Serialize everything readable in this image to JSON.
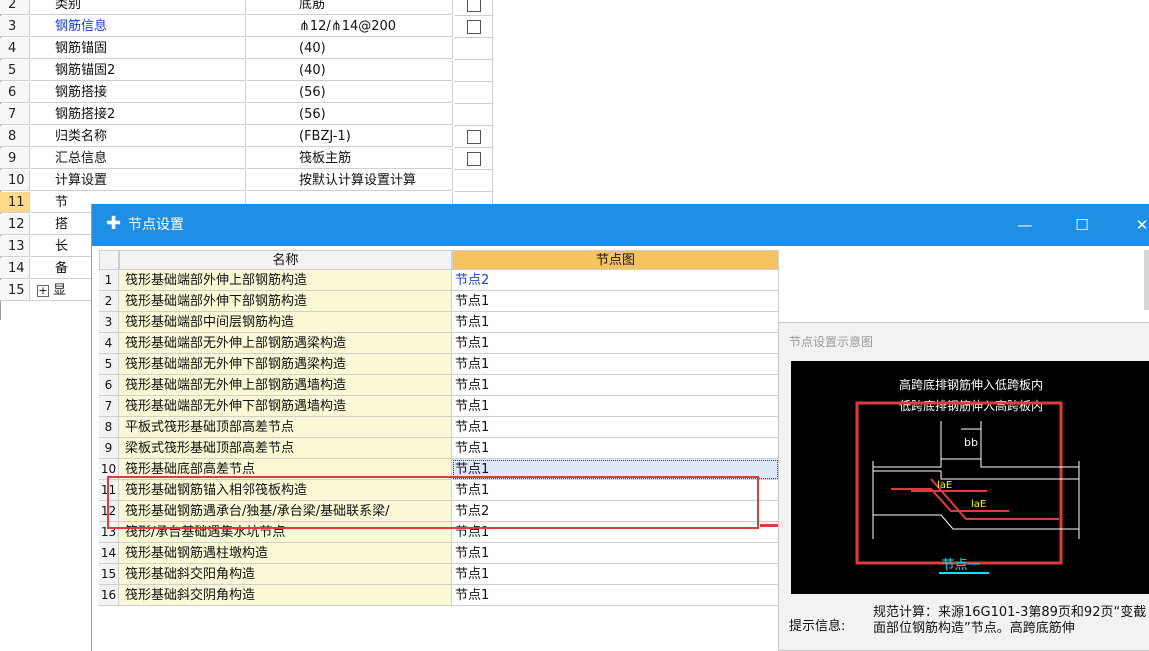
{
  "background_grid": {
    "rows": [
      {
        "num": "2",
        "name": "类别",
        "value": "底筋",
        "checkbox": true,
        "blue": false
      },
      {
        "num": "3",
        "name": "钢筋信息",
        "value": "⋔12/⋔14@200",
        "checkbox": true,
        "blue": true
      },
      {
        "num": "4",
        "name": "钢筋锚固",
        "value": "(40)",
        "checkbox": false,
        "blue": false
      },
      {
        "num": "5",
        "name": "钢筋锚固2",
        "value": "(40)",
        "checkbox": false,
        "blue": false
      },
      {
        "num": "6",
        "name": "钢筋搭接",
        "value": "(56)",
        "checkbox": false,
        "blue": false
      },
      {
        "num": "7",
        "name": "钢筋搭接2",
        "value": "(56)",
        "checkbox": false,
        "blue": false
      },
      {
        "num": "8",
        "name": "归类名称",
        "value": "(FBZJ-1)",
        "checkbox": true,
        "blue": false
      },
      {
        "num": "9",
        "name": "汇总信息",
        "value": "筏板主筋",
        "checkbox": true,
        "blue": false
      },
      {
        "num": "10",
        "name": "计算设置",
        "value": "按默认计算设置计算",
        "checkbox": false,
        "blue": false
      },
      {
        "num": "11",
        "name": "节",
        "value": "",
        "checkbox": false,
        "blue": false,
        "selected": true
      },
      {
        "num": "12",
        "name": "搭",
        "value": "",
        "checkbox": false,
        "blue": false
      },
      {
        "num": "13",
        "name": "长",
        "value": "",
        "checkbox": false,
        "blue": false
      },
      {
        "num": "14",
        "name": "备",
        "value": "",
        "checkbox": false,
        "blue": false
      },
      {
        "num": "15",
        "name": "显",
        "value": "",
        "checkbox": false,
        "blue": false,
        "expand": "+"
      }
    ]
  },
  "dialog": {
    "title": "节点设置",
    "icon": "app-plus-icon",
    "controls": {
      "minimize": "—",
      "maximize": "☐",
      "close": "✕"
    },
    "table": {
      "headers": {
        "name": "名称",
        "image": "节点图"
      },
      "rows": [
        {
          "num": "1",
          "name": "筏形基础端部外伸上部钢筋构造",
          "value": "节点2",
          "blue": true
        },
        {
          "num": "2",
          "name": "筏形基础端部外伸下部钢筋构造",
          "value": "节点1"
        },
        {
          "num": "3",
          "name": "筏形基础端部中间层钢筋构造",
          "value": "节点1"
        },
        {
          "num": "4",
          "name": "筏形基础端部无外伸上部钢筋遇梁构造",
          "value": "节点1"
        },
        {
          "num": "5",
          "name": "筏形基础端部无外伸下部钢筋遇梁构造",
          "value": "节点1"
        },
        {
          "num": "6",
          "name": "筏形基础端部无外伸上部钢筋遇墙构造",
          "value": "节点1"
        },
        {
          "num": "7",
          "name": "筏形基础端部无外伸下部钢筋遇墙构造",
          "value": "节点1"
        },
        {
          "num": "8",
          "name": "平板式筏形基础顶部高差节点",
          "value": "节点1"
        },
        {
          "num": "9",
          "name": "梁板式筏形基础顶部高差节点",
          "value": "节点1"
        },
        {
          "num": "10",
          "name": "筏形基础底部高差节点",
          "value": "节点1",
          "selected": true
        },
        {
          "num": "11",
          "name": "筏形基础钢筋锚入相邻筏板构造",
          "value": "节点1"
        },
        {
          "num": "12",
          "name": "筏形基础钢筋遇承台/独基/承台梁/基础联系梁/",
          "value": "节点2"
        },
        {
          "num": "13",
          "name": "筏形/承台基础遇集水坑节点",
          "value": "节点1"
        },
        {
          "num": "14",
          "name": "筏形基础钢筋遇柱墩构造",
          "value": "节点1"
        },
        {
          "num": "15",
          "name": "筏形基础斜交阳角构造",
          "value": "节点1"
        },
        {
          "num": "16",
          "name": "筏形基础斜交阴角构造",
          "value": "节点1"
        }
      ]
    },
    "preview": {
      "label": "节点设置示意图",
      "diagram_text": {
        "line1": "高跨底排钢筋伸入低跨板内",
        "line2": "低跨底排钢筋伸入高跨板内",
        "bb": "bb",
        "lae1": "laE",
        "lae2": "laE",
        "caption": "节点一"
      },
      "tip_label": "提示信息:",
      "tip_text": "规范计算：来源16G101-3第89页和92页“变截面部位钢筋构造”节点。高跨底筋伸"
    }
  }
}
